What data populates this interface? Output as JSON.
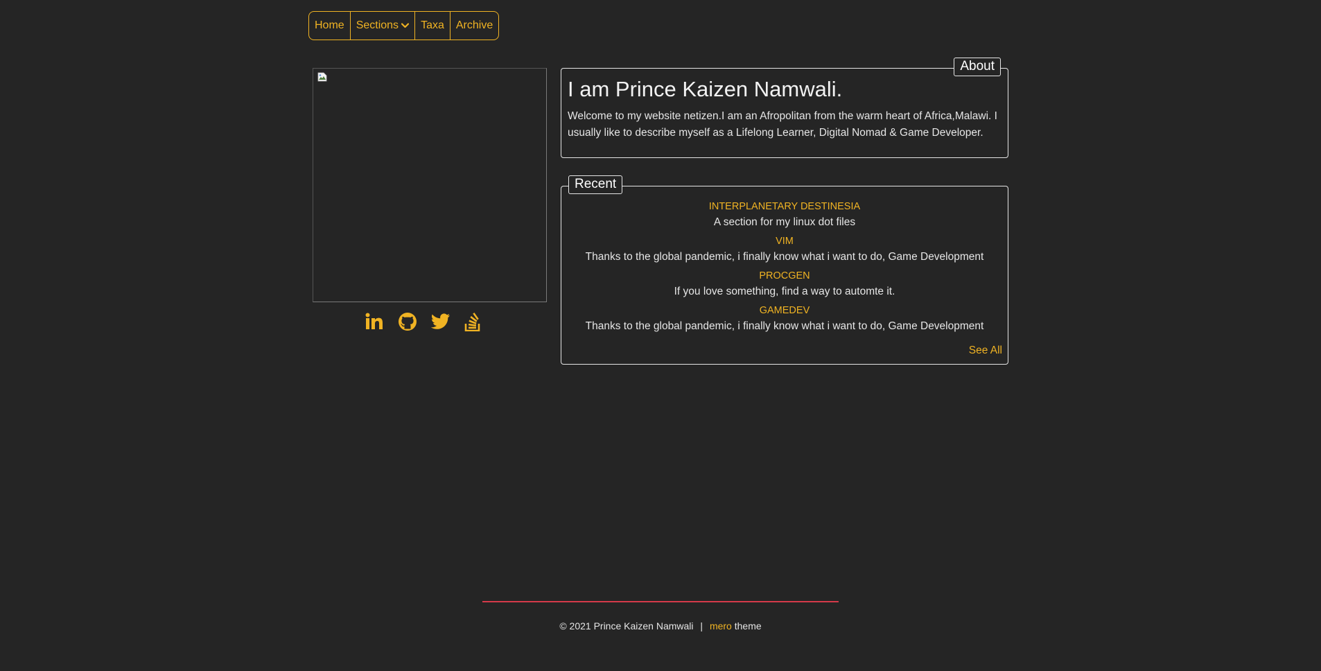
{
  "nav": {
    "items": [
      {
        "label": "Home"
      },
      {
        "label": "Sections"
      },
      {
        "label": "Taxa"
      },
      {
        "label": "Archive"
      }
    ]
  },
  "colors": {
    "background": "#252525",
    "accent": "#f0b323",
    "text": "#e6e6e6",
    "footer_rule": "#d63a4a"
  },
  "social": [
    "linkedin-icon",
    "github-icon",
    "twitter-icon",
    "stackoverflow-icon"
  ],
  "about": {
    "legend": "About",
    "heading": "I am Prince Kaizen Namwali.",
    "body": "Welcome to my website netizen.I am an Afropolitan from the warm heart of Africa,Malawi. I usually like to describe myself as a Lifelong Learner, Digital Nomad & Game Developer."
  },
  "recent": {
    "legend": "Recent",
    "posts": [
      {
        "title": "INTERPLANETARY DESTINESIA",
        "desc": "A section for my linux dot files"
      },
      {
        "title": "VIM",
        "desc": "Thanks to the global pandemic, i finally know what i want to do, Game Development"
      },
      {
        "title": "PROCGEN",
        "desc": "If you love something, find a way to automte it."
      },
      {
        "title": "GAMEDEV",
        "desc": "Thanks to the global pandemic, i finally know what i want to do, Game Development"
      }
    ],
    "see_all": "See All"
  },
  "footer": {
    "copyright": "© 2021 Prince Kaizen Namwali",
    "separator": "|",
    "theme_name": "mero",
    "theme_suffix": "theme"
  }
}
